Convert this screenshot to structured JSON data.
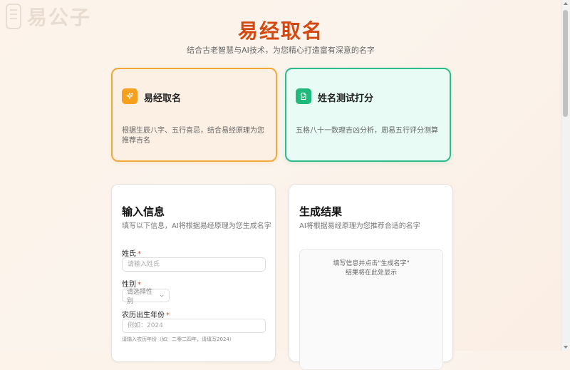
{
  "brand": {
    "logo_text": "易公子"
  },
  "hero": {
    "title": "易经取名",
    "subtitle": "结合古老智慧与AI技术，为您精心打造富有深意的名字"
  },
  "features": [
    {
      "title": "易经取名",
      "desc": "根据生辰八字、五行喜忌，结合易经原理为您推荐吉名",
      "color": "#f6a11d",
      "icon": "sparkle-icon"
    },
    {
      "title": "姓名测试打分",
      "desc": "五格八十一数理吉凶分析，周易五行评分测算",
      "color": "#1fb97b",
      "icon": "document-icon"
    }
  ],
  "input_card": {
    "title": "输入信息",
    "subtitle": "填写以下信息，AI将根据易经原理为您生成名字",
    "surname": {
      "label": "姓氏",
      "required_mark": "*",
      "placeholder": "请输入姓氏"
    },
    "gender": {
      "label": "性别",
      "required_mark": "*",
      "placeholder": "请选择性别"
    },
    "birth_year": {
      "label": "农历出生年份",
      "required_mark": "*",
      "placeholder": "例如：2024",
      "hint": "请输入农历年份（如：二零二四年，请填写2024）"
    }
  },
  "result_card": {
    "title": "生成结果",
    "subtitle": "AI将根据易经原理为您推荐合适的名字",
    "empty_line1": "填写信息并点击\"生成名字\"",
    "empty_line2": "结果将在此处显示"
  }
}
